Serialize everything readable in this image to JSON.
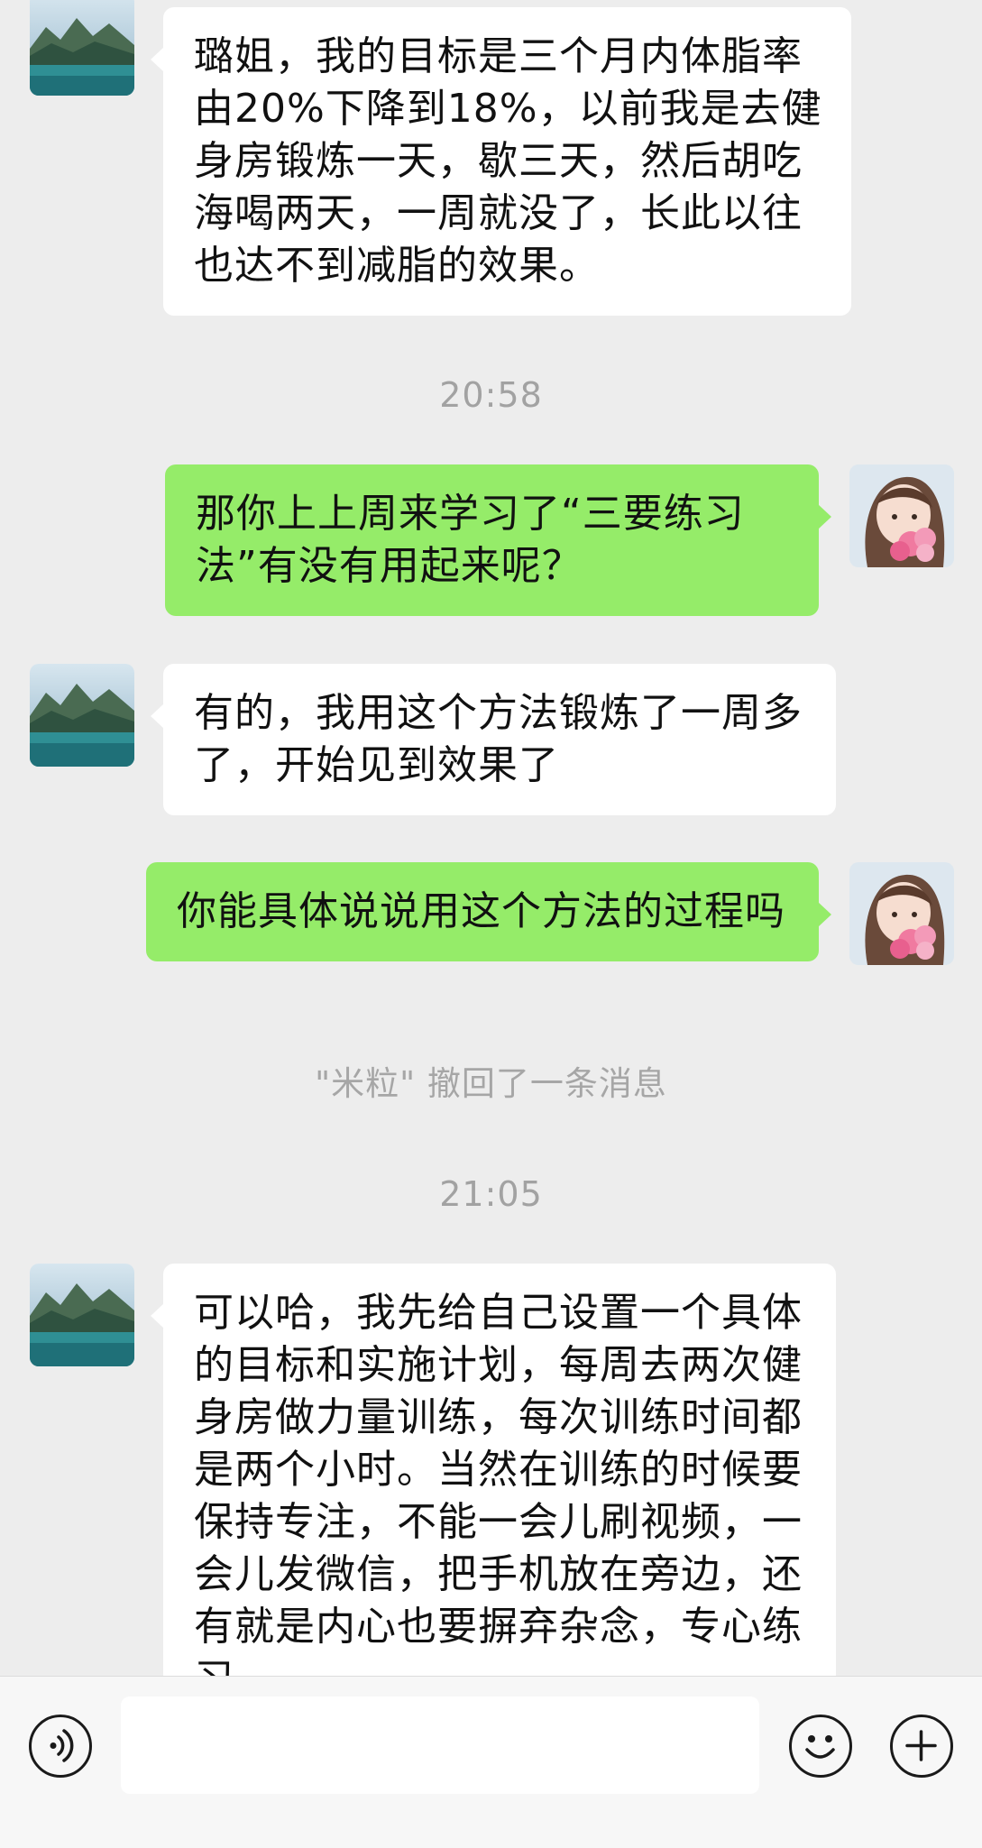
{
  "messages": [
    {
      "side": "in",
      "text": "璐姐，我的目标是三个月内体脂率由20%下降到18%，以前我是去健身房锻炼一天，歇三天，然后胡吃海喝两天，一周就没了，长此以往也达不到减脂的效果。"
    },
    {
      "timestamp": "20:58"
    },
    {
      "side": "out",
      "text": "那你上上周来学习了“三要练习法”有没有用起来呢？"
    },
    {
      "side": "in",
      "text": "有的，我用这个方法锻炼了一周多了，开始见到效果了"
    },
    {
      "side": "out",
      "text": "你能具体说说用这个方法的过程吗"
    },
    {
      "notice": "\"米粒\" 撤回了一条消息"
    },
    {
      "timestamp": "21:05"
    },
    {
      "side": "in",
      "text": "可以哈，我先给自己设置一个具体的目标和实施计划，每周去两次健身房做力量训练，每次训练时间都是两个小时。当然在训练的时候要保持专注，不能一会儿刷视频，一会儿发微信，把手机放在旁边，还有就是内心也要摒弃杂念，专心练习。"
    }
  ],
  "input_bar": {
    "message_input_value": "",
    "icons": [
      "voice-icon",
      "emoji-icon",
      "plus-icon"
    ]
  },
  "colors": {
    "background": "#ededed",
    "incoming_bubble": "#ffffff",
    "outgoing_bubble": "#95ec69",
    "timestamp_text": "#a2a2a2"
  }
}
